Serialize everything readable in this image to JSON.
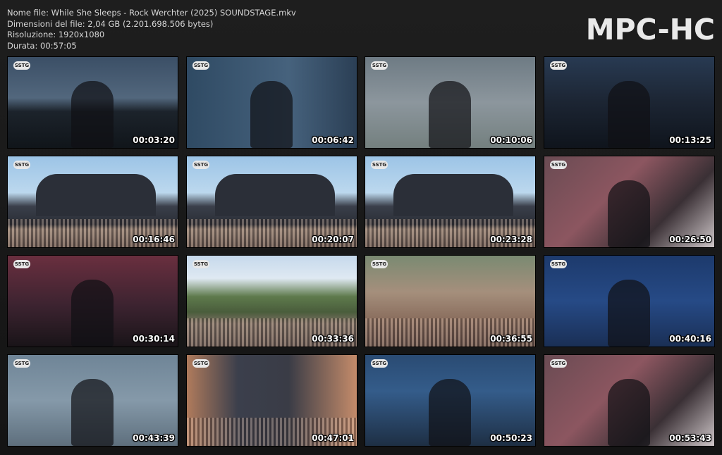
{
  "info": {
    "filename": "Nome file: While She Sleeps - Rock Werchter (2025) SOUNDSTAGE.mkv",
    "filesize": "Dimensioni del file: 2,04 GB (2.201.698.506 bytes)",
    "resolution": "Risoluzione: 1920x1080",
    "duration": "Durata: 00:57:05"
  },
  "brand": "MPC-HC",
  "thumbnails": [
    {
      "time": "00:03:20",
      "scene": "singer-stage-amps"
    },
    {
      "time": "00:06:42",
      "scene": "singer-closeup-blue"
    },
    {
      "time": "00:10:06",
      "scene": "guitarist-yellow-guitar"
    },
    {
      "time": "00:13:25",
      "scene": "wide-stage-band"
    },
    {
      "time": "00:16:46",
      "scene": "festival-stage-crowd"
    },
    {
      "time": "00:20:07",
      "scene": "festival-stage-crowd"
    },
    {
      "time": "00:23:28",
      "scene": "festival-stage-crowd"
    },
    {
      "time": "00:26:50",
      "scene": "drummer-red-backdrop"
    },
    {
      "time": "00:30:14",
      "scene": "singer-white-tank"
    },
    {
      "time": "00:33:36",
      "scene": "crowd-trees"
    },
    {
      "time": "00:36:55",
      "scene": "crowd-closeup"
    },
    {
      "time": "00:40:16",
      "scene": "singer-blue-stage"
    },
    {
      "time": "00:43:39",
      "scene": "hazy-drummer"
    },
    {
      "time": "00:47:01",
      "scene": "crowd-hands"
    },
    {
      "time": "00:50:23",
      "scene": "drummer-blue"
    },
    {
      "time": "00:53:43",
      "scene": "drummer-red-backdrop"
    }
  ],
  "channel_logo": "SSTG",
  "colors": {
    "background": "#1a1a1a",
    "text": "#d8d8d8"
  }
}
